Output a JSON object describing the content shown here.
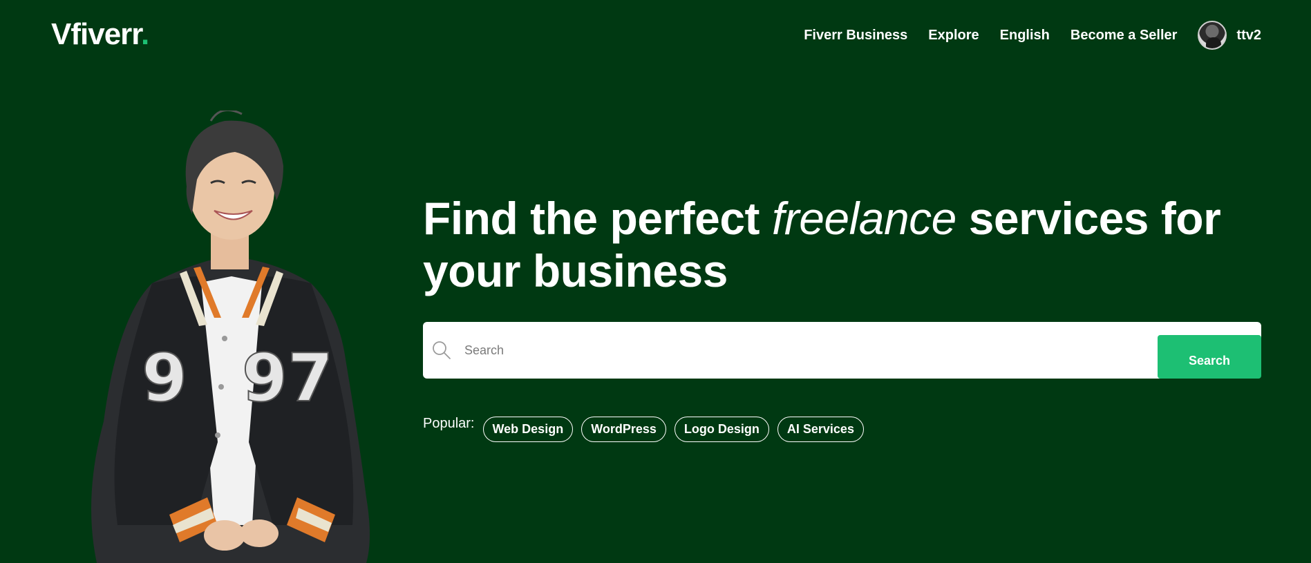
{
  "header": {
    "logo_text": "Vfiverr",
    "logo_dot": ".",
    "nav": {
      "business": "Fiverr Business",
      "explore": "Explore",
      "language": "English",
      "become_seller": "Become a Seller"
    },
    "user": {
      "name": "ttv2",
      "avatar_icon": "avatar-icon"
    }
  },
  "hero": {
    "title_part1": "Find the perfect ",
    "title_em": "freelance",
    "title_part2": " services for your business",
    "search": {
      "placeholder": "Search",
      "button_label": "Search",
      "icon": "search-icon"
    },
    "popular": {
      "label": "Popular:",
      "tags": [
        "Web Design",
        "WordPress",
        "Logo Design",
        "AI Services"
      ]
    },
    "person_jacket_number": "1997"
  },
  "colors": {
    "background": "#003912",
    "accent": "#1dbf73",
    "text": "#ffffff"
  }
}
